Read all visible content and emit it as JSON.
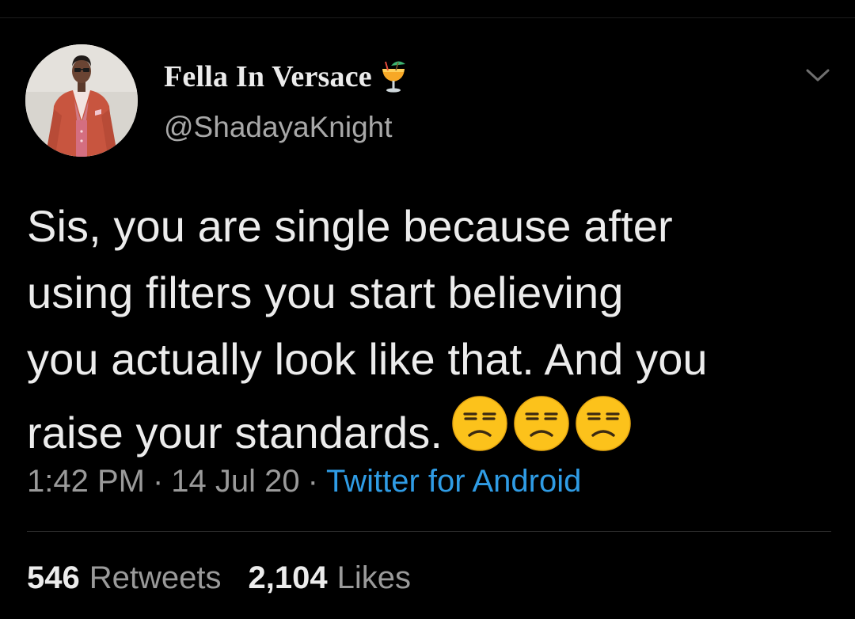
{
  "tweet": {
    "display_name": "Fella In Versace",
    "name_emoji": "tropical-drink-icon",
    "handle": "@ShadayaKnight",
    "text_lines": [
      "Sis, you are single because after",
      "using filters you start believing",
      "you actually look like that. And you",
      "raise your standards."
    ],
    "trailing_emojis": [
      "unamused-face-icon",
      "unamused-face-icon",
      "unamused-face-icon"
    ],
    "time": "1:42 PM",
    "separator": "·",
    "date": "14 Jul 20",
    "source": "Twitter for Android",
    "retweets_count": "546",
    "retweets_label": "Retweets",
    "likes_count": "2,104",
    "likes_label": "Likes"
  },
  "colors": {
    "background": "#000000",
    "text_primary": "#ececec",
    "text_secondary": "#9a9a9a",
    "link": "#2f9ce5",
    "divider": "#2a2a2a"
  },
  "icons": {
    "menu": "chevron-down-icon"
  }
}
